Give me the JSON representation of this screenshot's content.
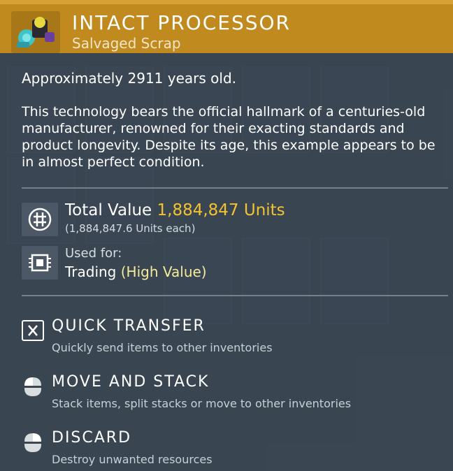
{
  "item": {
    "title": "INTACT PROCESSOR",
    "subtitle": "Salvaged Scrap",
    "icon": "processor-icon",
    "header_color": "#c08a1e"
  },
  "age_text": "Approximately 2911 years old.",
  "description": "This technology bears the official hallmark of a centuries-old manufacturer, renowned for their exacting standards and product longevity. Despite its age, this example appears to be in almost perfect condition.",
  "value": {
    "label": "Total Value ",
    "amount": "1,884,847 Units",
    "each": "(1,884,847.6 Units each)",
    "icon": "units-icon",
    "amount_color": "#f2c230"
  },
  "usage": {
    "label": "Used for:",
    "value": "Trading ",
    "highlight": "(High Value)",
    "icon": "chip-icon"
  },
  "actions": [
    {
      "title": "QUICK TRANSFER",
      "desc": "Quickly send items to other inventories",
      "icon": "x-key-icon"
    },
    {
      "title": "MOVE AND STACK",
      "desc": "Stack items, split stacks or move to other inventories",
      "icon": "mouse-left-icon"
    },
    {
      "title": "DISCARD",
      "desc": "Destroy unwanted resources",
      "icon": "mouse-right-icon"
    }
  ]
}
